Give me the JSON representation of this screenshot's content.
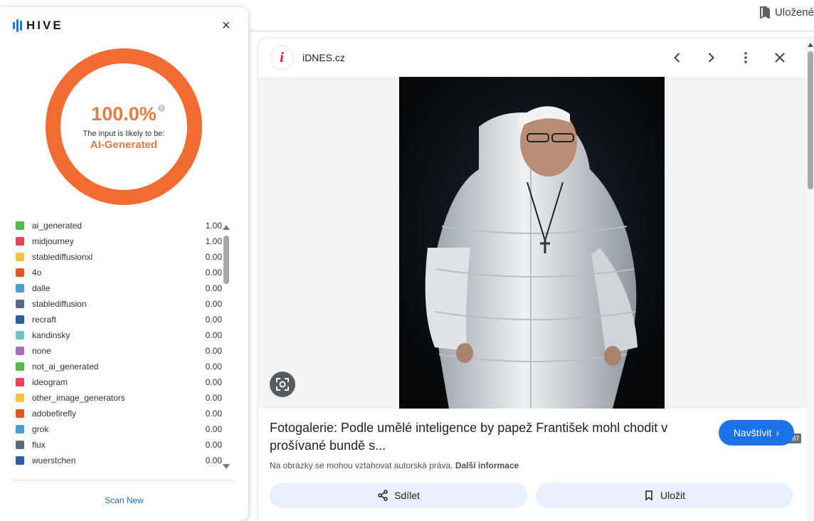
{
  "browser": {
    "saved_label": "Uložené"
  },
  "hive": {
    "brand": "HIVE",
    "score": "100.0%",
    "likely_text": "The input is likely to be:",
    "verdict": "AI-Generated",
    "classes": [
      {
        "name": "ai_generated",
        "value": "1.00",
        "color": "#52b848"
      },
      {
        "name": "midjourney",
        "value": "1.00",
        "color": "#e8435a"
      },
      {
        "name": "stablediffusionxl",
        "value": "0.00",
        "color": "#f5c342"
      },
      {
        "name": "4o",
        "value": "0.00",
        "color": "#e0581f"
      },
      {
        "name": "dalle",
        "value": "0.00",
        "color": "#4a9ad4"
      },
      {
        "name": "stablediffusion",
        "value": "0.00",
        "color": "#5a6a80"
      },
      {
        "name": "recraft",
        "value": "0.00",
        "color": "#2b5ea8"
      },
      {
        "name": "kandinsky",
        "value": "0.00",
        "color": "#6ec8c0"
      },
      {
        "name": "none",
        "value": "0.00",
        "color": "#a86cc4"
      },
      {
        "name": "not_ai_generated",
        "value": "0.00",
        "color": "#52b848"
      },
      {
        "name": "ideogram",
        "value": "0.00",
        "color": "#e8435a"
      },
      {
        "name": "other_image_generators",
        "value": "0.00",
        "color": "#f5c342"
      },
      {
        "name": "adobefirefly",
        "value": "0.00",
        "color": "#e0581f"
      },
      {
        "name": "grok",
        "value": "0.00",
        "color": "#4a9ad4"
      },
      {
        "name": "flux",
        "value": "0.00",
        "color": "#5a6a80"
      },
      {
        "name": "wuerstchen",
        "value": "0.00",
        "color": "#2b5ea8"
      }
    ],
    "scan_new": "Scan New"
  },
  "viewer": {
    "site_icon_letter": "i",
    "site_name": "iDNES.cz",
    "image_dims": "630 × 787",
    "caption": "Fotogalerie: Podle umělé inteligence by papež František mohl chodit v prošívané bundě s...",
    "visit_label": "Navštívit",
    "copyright_text": "Na obrázky se mohou vztahovat autorská práva.",
    "more_info": "Další informace",
    "share_label": "Sdílet",
    "save_label": "Uložit"
  }
}
